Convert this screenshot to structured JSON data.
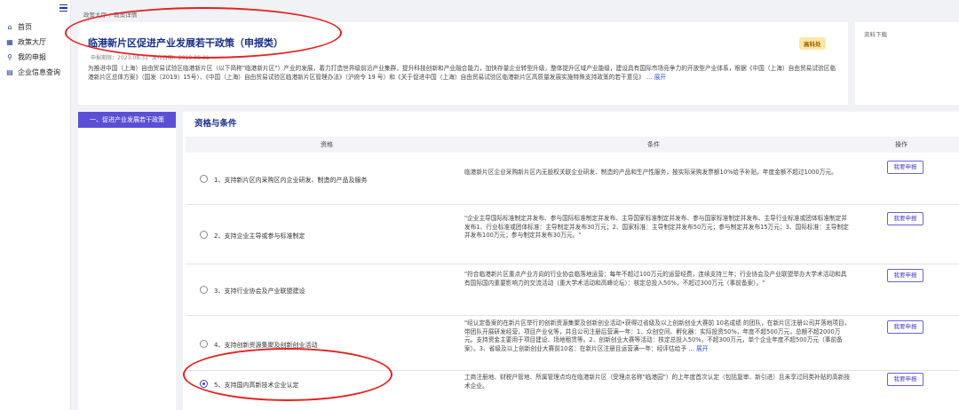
{
  "sidebar": {
    "items": [
      {
        "icon": "home-icon",
        "glyph": "⌂",
        "label": "首页"
      },
      {
        "icon": "grid-icon",
        "glyph": "▦",
        "label": "政策大厅"
      },
      {
        "icon": "search-icon",
        "glyph": "⚲",
        "label": "我的申报"
      },
      {
        "icon": "document-icon",
        "glyph": "▤",
        "label": "企业信息查询"
      }
    ]
  },
  "breadcrumb": {
    "root": "政策大厅",
    "current": "政策详情"
  },
  "policy": {
    "title": "临港新片区促进产业发展若干政策（申报类）",
    "star": "☆",
    "declare_period": "申报期限：2023-08-31",
    "publish_date": "发布日期：2019-09-01",
    "badge": "高科处",
    "summary": "为推进中国（上海）自由贸易试验区临港新片区（以下简称\"临港新片区\"）产业的发展，着力打造世界级前沿产业集群，提升科技创新和产业融合能力，加快存量企业转型升级，整体提升区域产业能级，建设具有国际市场竞争力的开放型产业体系，根据《中国（上海）自由贸易试验区临港新片区总体方案》（国发〔2019〕15号）、《中国（上海）自由贸易试验区临港新片区管理办法》（沪府令 19 号）和《关于促进中国（上海）自由贸易试验区临港新片区高质量发展实施特殊支持政策的若干意见》",
    "expand": "… 展开"
  },
  "download": {
    "title": "资料下载"
  },
  "category": {
    "label": "一、促进产业发展若干政策"
  },
  "section": {
    "title": "资格与条件"
  },
  "table": {
    "headers": {
      "qualification": "资格",
      "condition": "条件",
      "action": "操作"
    },
    "rows": [
      {
        "checked": false,
        "qualification": "1、支持新片区内采购区内企业研发、制造的产品及服务",
        "condition": "临港新片区企业采购新片区内无股权关联企业研发、制造的产品和生产性服务，按实际采购发票额10%给予补贴，年度金额不超过1000万元。",
        "action": "我要申报"
      },
      {
        "checked": false,
        "qualification": "2、支持企业主导或参与标准制定",
        "condition": "\"企业主导国际标准制定并发布、参与国际标准制定并发布、主导国家标准制定并发布、参与国家标准制定并发布、主导行业标准或团体标准制定并发布1、行业标准或团体标准：主导制定并发布30万元；2、国家标准：主导制定并发布50万元；参与制定并发布15万元；3、国际标准：主导制定并发布100万元；参与制定并发布30万元。\"",
        "action": "我要申报"
      },
      {
        "checked": false,
        "qualification": "3、支持行业协会及产业联盟建设",
        "condition": "\"符合临港新片区重点产业方向的行业协会临落地运营：每年不超过100万元的运营经费，连续支持三年；行业协会及产业联盟举办大学术活动和具有国际国内重要影响力的交流活动（重大学术活动和高峰论坛）：核定总投入50%，不超过300万元（事前备案）。\"",
        "action": "我要申报"
      },
      {
        "checked": false,
        "qualification": "4、支持创新资源集聚及创新创业活动",
        "condition": "\"经认定备案的在新片区举行的创新资源集聚及创新创业活动•获得过省级及以上创新创业大赛前 10名成绩 的团队，在新片区注册公司并落地项目，带团队开展研发经营，项目产业化等，并且公司注册后营满一年：1、众创空间、孵化器：实际投资50%，年度不超500万元，总额不超2000万元。支持资金主要用于项目建设、场地租赁等。2、创新创业大赛等活动：核定总投入50%，不超300万元，单个企业年度不超500万元（事前备案）。3、省级及以上创新创业大赛前10名：在新片区注册且运营满一年：经评估给予 …",
        "expand": "展开",
        "action": "我要申报"
      },
      {
        "checked": true,
        "qualification": "5、支持国内高新技术企业认定",
        "condition": "工商注册地、财税户管地、所属管理点均在临港新片区（受理点名称\"临港园\"）的上年度首次认定（包括复审、新引进）且未享过同类补贴的高新技术企业。",
        "action": "我要申报"
      }
    ]
  }
}
